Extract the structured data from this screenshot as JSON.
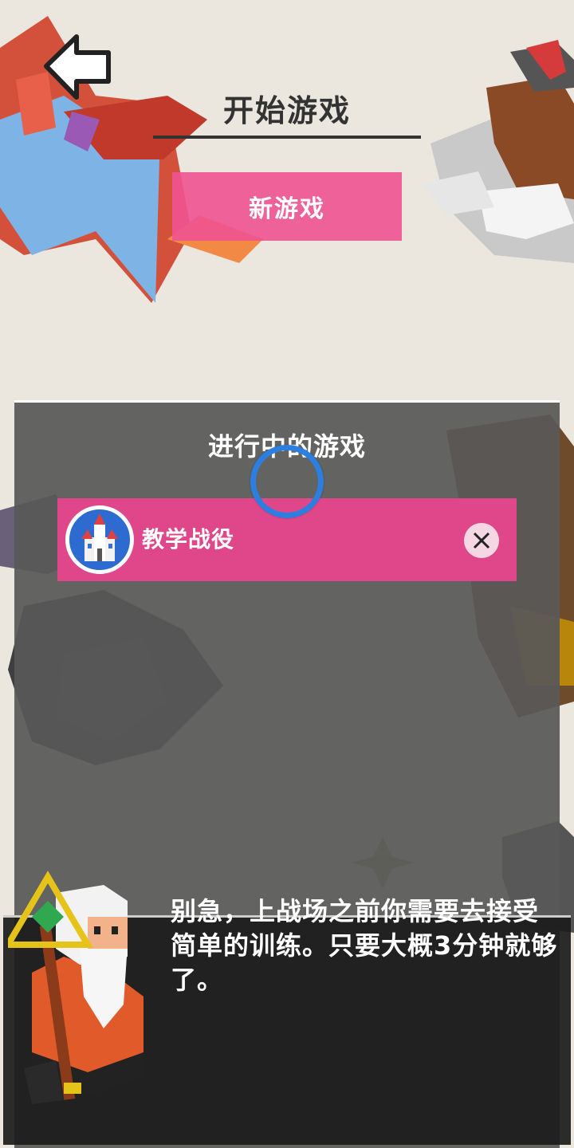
{
  "header": {
    "back_icon": "arrow-left-icon",
    "title": "开始游戏",
    "new_game_label": "新游戏"
  },
  "ongoing": {
    "title": "进行中的游戏",
    "games": [
      {
        "label": "教学战役",
        "avatar_icon": "castle-icon",
        "close_icon": "close-icon"
      }
    ],
    "loading_icon": "loading-ring-icon"
  },
  "dialog": {
    "speaker_icon": "wizard-icon",
    "text": "别急，上战场之前你需要去接受简单的训练。只要大概3分钟就够了。"
  },
  "colors": {
    "background": "#ebe6de",
    "accent_pink": "#ef5291",
    "row_pink": "#e0478a",
    "panel_gray": "#585858",
    "loading_blue": "#2c7fe0"
  }
}
